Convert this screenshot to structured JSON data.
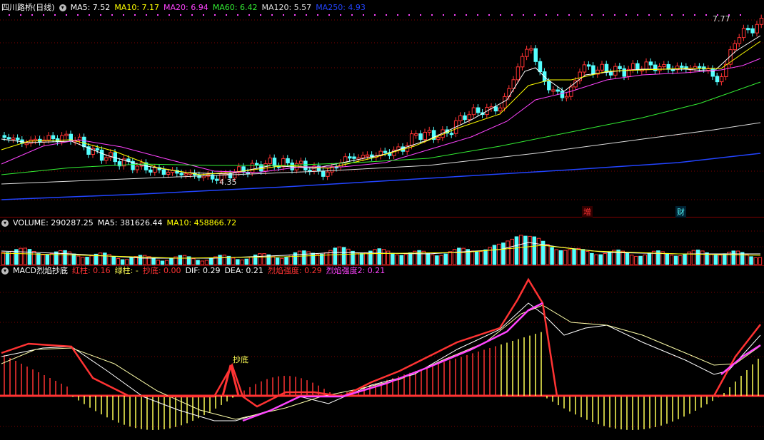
{
  "main": {
    "title": "四川路桥(日线)",
    "ma": [
      {
        "label": "MA5: 7.52",
        "color": "#ffffff"
      },
      {
        "label": "MA10: 7.17",
        "color": "#ffff00"
      },
      {
        "label": "MA20: 6.94",
        "color": "#ff44ff"
      },
      {
        "label": "MA60: 6.42",
        "color": "#33ee33"
      },
      {
        "label": "MA120: 5.57",
        "color": "#dddddd"
      },
      {
        "label": "MA250: 4.93",
        "color": "#2244ff"
      }
    ],
    "high_label": "7.77",
    "low_label": "4.35",
    "event_markers": [
      "增",
      "财"
    ]
  },
  "volume": {
    "title": "VOLUME: 290287.25",
    "ma5": "MA5: 381626.44",
    "ma10": "MA10: 458866.72"
  },
  "macd": {
    "title": "MACD烈焰抄底",
    "items": [
      {
        "label": "红柱: 0.16",
        "color": "#ff3333"
      },
      {
        "label": "绿柱: -",
        "color": "#ffff55"
      },
      {
        "label": "抄底: 0.00",
        "color": "#ff3333"
      },
      {
        "label": "DIF: 0.29",
        "color": "#ffffff"
      },
      {
        "label": "DEA: 0.21",
        "color": "#ffffff"
      },
      {
        "label": "烈焰强度: 0.29",
        "color": "#ff3333"
      },
      {
        "label": "烈焰强度2: 0.21",
        "color": "#ff44ff"
      }
    ],
    "signal_label": "抄底"
  },
  "colors": {
    "up": "#ff3333",
    "down": "#54ffff",
    "grid": "#800000",
    "bg": "#000000"
  }
}
